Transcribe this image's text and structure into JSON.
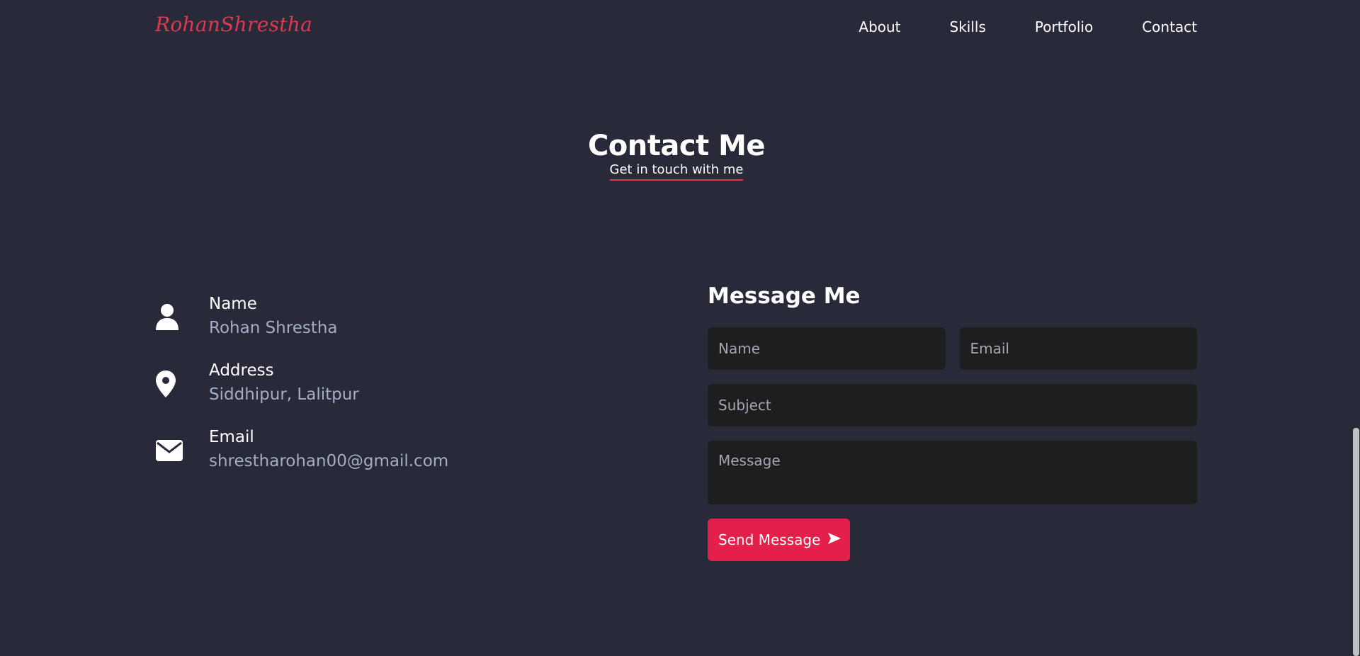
{
  "navbar": {
    "logo": "RohanShrestha",
    "links": [
      "About",
      "Skills",
      "Portfolio",
      "Contact"
    ]
  },
  "section": {
    "title": "Contact Me",
    "subtitle": "Get in touch with me"
  },
  "info": [
    {
      "label": "Name",
      "value": "Rohan Shrestha",
      "icon": "user-icon"
    },
    {
      "label": "Address",
      "value": "Siddhipur, Lalitpur",
      "icon": "map-pin-icon"
    },
    {
      "label": "Email",
      "value": "shrestharohan00@gmail.com",
      "icon": "envelope-icon"
    }
  ],
  "form": {
    "title": "Message Me",
    "name_placeholder": "Name",
    "email_placeholder": "Email",
    "subject_placeholder": "Subject",
    "message_placeholder": "Message",
    "send_label": "Send Message",
    "send_icon": "send-arrow-icon"
  },
  "colors": {
    "background": "#282a3a",
    "accent": "#e2204b",
    "muted_text": "#a3aec4",
    "field_bg": "#1e1e1e"
  }
}
